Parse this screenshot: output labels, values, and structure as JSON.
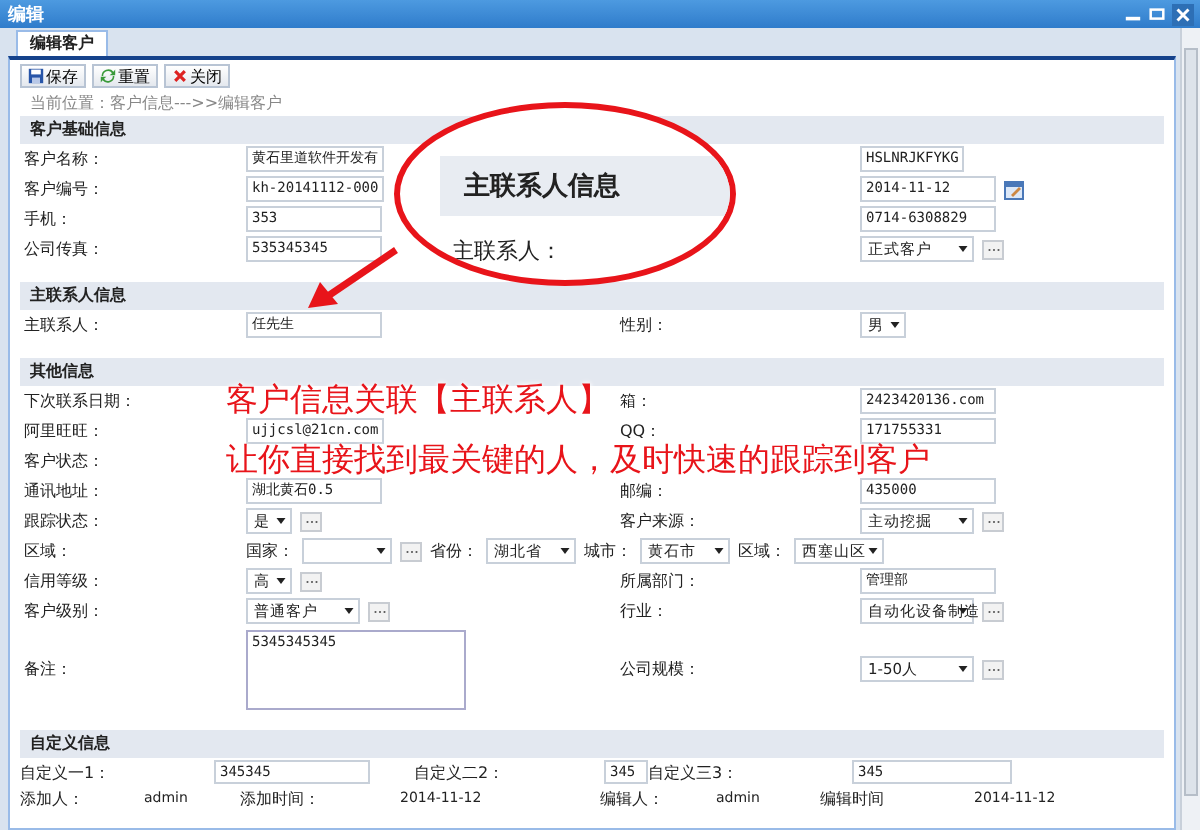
{
  "window": {
    "title": "编辑"
  },
  "tabs": [
    {
      "label": "编辑客户",
      "selected": true
    }
  ],
  "toolbar": [
    {
      "kind": "save",
      "label": "保存"
    },
    {
      "kind": "reset",
      "label": "重置"
    },
    {
      "kind": "close",
      "label": "关闭"
    }
  ],
  "breadcrumb": "当前位置：客户信息--->>编辑客户",
  "sections": [
    {
      "title": "客户基础信息",
      "rows": [
        {
          "left": {
            "label": "客户名称：",
            "kind": "text",
            "value": "黄石里道软件开发有"
          },
          "right": {
            "kind": "short",
            "value": "HSLNRJKFYKG"
          }
        },
        {
          "left": {
            "label": "客户编号：",
            "kind": "text",
            "value": "kh-20141112-000"
          },
          "right": {
            "kind": "date",
            "value": "2014-11-12"
          }
        },
        {
          "left": {
            "label": "手机：",
            "kind": "text",
            "value": "353"
          },
          "right": {
            "kind": "text",
            "value": "0714-6308829"
          }
        },
        {
          "left": {
            "label": "公司传真：",
            "kind": "text",
            "value": "535345345"
          },
          "right": {
            "kind": "select_more",
            "value": "正式客户"
          }
        }
      ]
    },
    {
      "title": "主联系人信息",
      "rows": [
        {
          "left": {
            "label": "主联系人：",
            "kind": "text",
            "value": "任先生"
          },
          "right": {
            "label": "性别：",
            "kind": "select",
            "value": "男"
          }
        }
      ]
    },
    {
      "title": "其他信息",
      "rows": [
        {
          "left": {
            "label": "下次联系日期："
          },
          "right": {
            "label": "箱：",
            "kind": "text",
            "value": "2423420136.com"
          }
        },
        {
          "left": {
            "label": "阿里旺旺：",
            "kind": "text",
            "value": "ujjcsl@21cn.com"
          },
          "right": {
            "label": "QQ：",
            "kind": "text",
            "value": "171755331"
          }
        },
        {
          "left": {
            "label": "客户状态："
          }
        },
        {
          "left": {
            "label": "通讯地址：",
            "kind": "text",
            "value": "湖北黄石0.5"
          },
          "right": {
            "label": "邮编：",
            "kind": "text",
            "value": "435000"
          }
        },
        {
          "left": {
            "label": "跟踪状态：",
            "kind": "select_more",
            "value": "是"
          },
          "right": {
            "label": "客户来源：",
            "kind": "select_more",
            "value": "主动挖掘"
          }
        },
        {
          "kind": "region",
          "label": "区域：",
          "parts": [
            {
              "label": "国家：",
              "kind": "select_more"
            },
            {
              "label": "省份：",
              "value": "湖北省",
              "kind": "select"
            },
            {
              "label": "城市：",
              "value": "黄石市",
              "kind": "select"
            },
            {
              "label": "区域：",
              "value": "西塞山区",
              "kind": "select"
            }
          ]
        },
        {
          "left": {
            "label": "信用等级：",
            "kind": "select_more",
            "value": "高"
          },
          "right": {
            "label": "所属部门：",
            "kind": "text",
            "value": "管理部"
          }
        },
        {
          "left": {
            "label": "客户级别：",
            "kind": "select_more",
            "value": "普通客户"
          },
          "right": {
            "label": "行业：",
            "kind": "select_more",
            "value": "自动化设备制造"
          }
        },
        {
          "kind": "tall",
          "left": {
            "label": "备注：",
            "kind": "textarea",
            "value": "5345345345"
          },
          "right": {
            "label": "公司规模：",
            "kind": "select_more",
            "value": "1-50人"
          }
        }
      ]
    }
  ],
  "custom": {
    "title": "自定义信息",
    "fields": [
      {
        "label": "自定义一1：",
        "value": "345345"
      },
      {
        "label": "自定义二2：",
        "value": "345"
      },
      {
        "label": "自定义三3：",
        "value": "345"
      }
    ]
  },
  "footer": [
    {
      "label": "添加人：",
      "value": "admin"
    },
    {
      "label": "添加时间：",
      "value": "2014-11-12"
    },
    {
      "label": "编辑人：",
      "value": "admin"
    },
    {
      "label": "编辑时间",
      "value": "2014-11-12"
    }
  ],
  "callout": {
    "heading": "主联系人信息",
    "label": "主联系人："
  },
  "banner": [
    "客户信息关联【主联系人】",
    "让你直接找到最关键的人，及时快速的跟踪到客户"
  ]
}
